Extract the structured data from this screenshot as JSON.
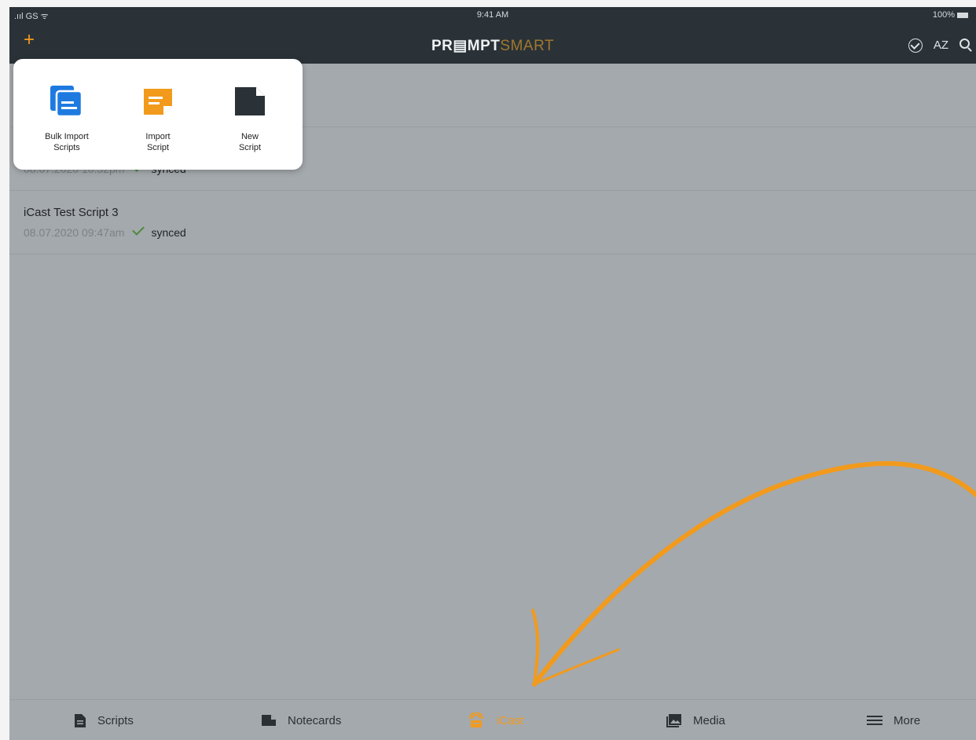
{
  "status_bar": {
    "carrier": ".ııl GS ᯤ",
    "time": "9:41 AM",
    "battery": "100%"
  },
  "header": {
    "add_glyph": "+",
    "logo_part1": "PR▤MPT",
    "logo_part2": "SMART",
    "az_label": "AZ"
  },
  "popover": {
    "items": [
      {
        "label": "Bulk Import\nScripts",
        "icon": "bulk-import-icon",
        "color": "#1f7ae0"
      },
      {
        "label": "Import\nScript",
        "icon": "import-script-icon",
        "color": "#f29a1c"
      },
      {
        "label": "New\nScript",
        "icon": "new-script-icon",
        "color": "#2a3238"
      }
    ]
  },
  "scripts": [
    {
      "title": "",
      "date": "",
      "status": ""
    },
    {
      "title": "",
      "date": "08.07.2020 10:32pm",
      "status": "synced"
    },
    {
      "title": "iCast Test Script 3",
      "date": "08.07.2020 09:47am",
      "status": "synced"
    }
  ],
  "tabs": [
    {
      "label": "Scripts",
      "icon": "script-icon",
      "active": false
    },
    {
      "label": "Notecards",
      "icon": "notecard-icon",
      "active": false
    },
    {
      "label": "iCast",
      "icon": "icast-icon",
      "active": true
    },
    {
      "label": "Media",
      "icon": "media-icon",
      "active": false
    },
    {
      "label": "More",
      "icon": "menu-icon",
      "active": false
    }
  ],
  "colors": {
    "accent": "#f29a1c",
    "header": "#2a3238",
    "background": "#a4a9ad",
    "synced_check": "#4c8a3e"
  }
}
